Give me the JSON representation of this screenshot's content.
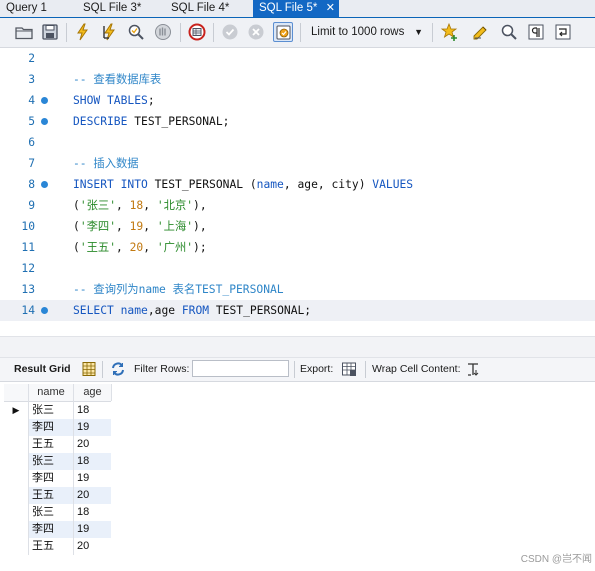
{
  "tabs": [
    {
      "label": "Query 1",
      "active": false
    },
    {
      "label": "SQL File 3*",
      "active": false
    },
    {
      "label": "SQL File 4*",
      "active": false
    },
    {
      "label": "SQL File 5*",
      "active": true
    }
  ],
  "tab_close_glyph": "✕",
  "toolbar": {
    "icons": [
      "open-folder-icon",
      "save-icon",
      "execute-icon",
      "execute-current-icon",
      "explain-icon",
      "stop-icon",
      "toggle-results-icon",
      "commit-icon",
      "rollback-icon",
      "autocommit-icon",
      "bookmark-icon",
      "beautify-icon",
      "find-icon",
      "invisible-chars-icon",
      "wrap-icon"
    ],
    "limit_select": {
      "value": "Limit to 1000 rows"
    }
  },
  "editor": {
    "lines": [
      {
        "num": "2",
        "dot": false,
        "text": ""
      },
      {
        "num": "3",
        "dot": false,
        "text": "-- 查看数据库表"
      },
      {
        "num": "4",
        "dot": true,
        "text": "SHOW TABLES;"
      },
      {
        "num": "5",
        "dot": true,
        "text": "DESCRIBE TEST_PERSONAL;"
      },
      {
        "num": "6",
        "dot": false,
        "text": ""
      },
      {
        "num": "7",
        "dot": false,
        "text": "-- 插入数据"
      },
      {
        "num": "8",
        "dot": true,
        "text": "INSERT INTO TEST_PERSONAL (name, age, city) VALUES"
      },
      {
        "num": "9",
        "dot": false,
        "text": "('张三', 18, '北京'),"
      },
      {
        "num": "10",
        "dot": false,
        "text": "('李四', 19, '上海'),"
      },
      {
        "num": "11",
        "dot": false,
        "text": "('王五', 20, '广州');"
      },
      {
        "num": "12",
        "dot": false,
        "text": ""
      },
      {
        "num": "13",
        "dot": false,
        "text": "-- 查询列为name 表名TEST_PERSONAL"
      },
      {
        "num": "14",
        "dot": true,
        "text": "SELECT name,age FROM TEST_PERSONAL;"
      }
    ]
  },
  "results_toolbar": {
    "result_grid_label": "Result Grid",
    "filter_label": "Filter Rows:",
    "filter_value": "",
    "export_label": "Export:",
    "wrap_label": "Wrap Cell Content:"
  },
  "grid": {
    "columns": [
      "name",
      "age"
    ],
    "current_row_marker": "▶",
    "rows": [
      [
        "张三",
        "18"
      ],
      [
        "李四",
        "19"
      ],
      [
        "王五",
        "20"
      ],
      [
        "张三",
        "18"
      ],
      [
        "李四",
        "19"
      ],
      [
        "王五",
        "20"
      ],
      [
        "张三",
        "18"
      ],
      [
        "李四",
        "19"
      ],
      [
        "王五",
        "20"
      ]
    ]
  },
  "watermark": "CSDN @岂不闻",
  "colors": {
    "active_tab": "#1368c4",
    "keyword": "#1556c0",
    "comment": "#2f86c8",
    "string": "#2a8a2a",
    "number": "#c27a12",
    "line_number": "#1f6fb2",
    "row_alt": "#e9f0fa"
  }
}
